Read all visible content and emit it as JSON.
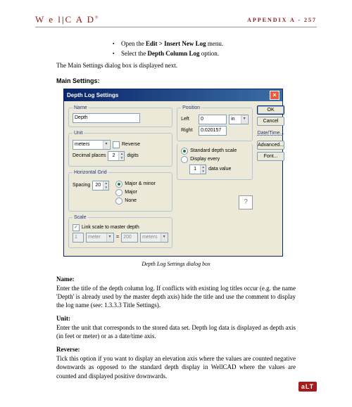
{
  "header": {
    "logo_left": "W e l",
    "logo_right": "C A D",
    "appendix": "APPENDIX A - 257"
  },
  "bullets": [
    {
      "pre": "Open the ",
      "bold": "Edit > Insert New Log",
      "post": " menu."
    },
    {
      "pre": "Select the ",
      "bold": "Depth Column Log",
      "post": " option."
    }
  ],
  "intro": "The Main Settings dialog box is displayed next.",
  "main_heading": "Main Settings:",
  "dialog": {
    "title": "Depth Log Settings",
    "name": {
      "legend": "Name",
      "value": "Depth"
    },
    "unit": {
      "legend": "Unit",
      "combo": "meters",
      "reverse_label": "Reverse",
      "dec_label": "Decimal places",
      "dec_value": "2",
      "digits": "digits"
    },
    "hgrid": {
      "legend": "Horizontal Grid",
      "spacing_label": "Spacing",
      "spacing_value": "20",
      "r1": "Major & minor",
      "r2": "Major",
      "r3": "None"
    },
    "scale": {
      "legend": "Scale",
      "link_label": "Link scale to master depth",
      "v1": "1",
      "u1": "meter",
      "eq": "=",
      "v2": "200",
      "u2": "meters"
    },
    "position": {
      "legend": "Position",
      "left_label": "Left",
      "left_value": "0",
      "right_label": "Right",
      "right_value": "0.020157",
      "unit": "in"
    },
    "opts": {
      "r1": "Standard depth scale",
      "r2": "Display every",
      "r2_value": "1",
      "r2_suffix": "data value"
    },
    "buttons": {
      "ok": "OK",
      "cancel": "Cancel",
      "datetime": "Date/Time...",
      "advanced": "Advanced...",
      "font": "Font..."
    }
  },
  "caption": "Depth Log Settings dialog box",
  "sections": {
    "name": {
      "term": "Name:",
      "text": "Enter the title of the depth column log. If conflicts with existing log titles occur (e.g. the name 'Depth' is already used by the master depth axis) hide the title and use the comment to display the log name (see: 1.3.3.3 Title Settings)."
    },
    "unit": {
      "term": "Unit:",
      "text": "Enter the unit that corresponds to the stored data set. Depth log data is displayed as depth axis (in feet or meter) or as a date/time axis."
    },
    "reverse": {
      "term": "Reverse:",
      "text": "Tick this option if you want to display an elevation axis where the values are counted negative downwards as opposed to the standard depth display in WellCAD where the values are counted and displayed positive downwards."
    }
  },
  "footer_logo": "aLT"
}
